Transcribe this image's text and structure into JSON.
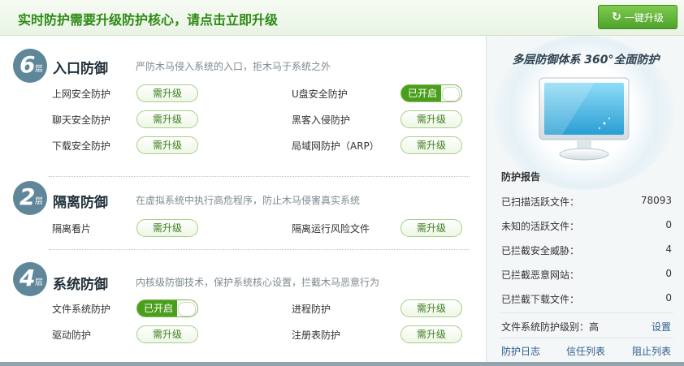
{
  "header": {
    "title": "实时防护需要升级防护核心，请点击立即升级",
    "upgrade_label": "一键升级",
    "upgrade_icon": "refresh-icon"
  },
  "sections": [
    {
      "layers": "6",
      "layer_unit": "层",
      "title": "入口防御",
      "desc": "严防木马侵入系统的入口，拒木马于系统之外",
      "items": [
        {
          "label": "上网安全防护",
          "status": "需升级"
        },
        {
          "label": "U盘安全防护",
          "status": "已开启"
        },
        {
          "label": "聊天安全防护",
          "status": "需升级"
        },
        {
          "label": "黑客入侵防护",
          "status": "需升级"
        },
        {
          "label": "下载安全防护",
          "status": "需升级"
        },
        {
          "label": "局域网防护（ARP）",
          "status": "需升级"
        }
      ]
    },
    {
      "layers": "2",
      "layer_unit": "层",
      "title": "隔离防御",
      "desc": "在虚拟系统中执行高危程序，防止木马侵害真实系统",
      "items": [
        {
          "label": "隔离看片",
          "status": "需升级"
        },
        {
          "label": "隔离运行风险文件",
          "status": "需升级"
        }
      ]
    },
    {
      "layers": "4",
      "layer_unit": "层",
      "title": "系统防御",
      "desc": "内核级防御技术，保护系统核心设置，拦截木马恶意行为",
      "items": [
        {
          "label": "文件系统防护",
          "status": "已开启"
        },
        {
          "label": "进程防护",
          "status": "需升级"
        },
        {
          "label": "驱动防护",
          "status": "需升级"
        },
        {
          "label": "注册表防护",
          "status": "需升级"
        }
      ]
    }
  ],
  "panel": {
    "title": "多层防御体系 360°全面防护",
    "report_title": "防护报告",
    "stats": [
      {
        "label": "已扫描活跃文件：",
        "value": "78093"
      },
      {
        "label": "未知的活跃文件：",
        "value": "0"
      },
      {
        "label": "已拦截安全威胁：",
        "value": "4"
      },
      {
        "label": "已拦截恶意网站：",
        "value": "0"
      },
      {
        "label": "已拦截下载文件：",
        "value": "0"
      }
    ],
    "level_text": "文件系统防护级别：高",
    "settings_label": "设置",
    "links": [
      "防护日志",
      "信任列表",
      "阻止列表"
    ]
  },
  "colors": {
    "accent_green": "#4a9e1c",
    "title_green": "#2e8a15",
    "badge_blue": "#5f8799",
    "link_blue": "#2d5d8b"
  }
}
